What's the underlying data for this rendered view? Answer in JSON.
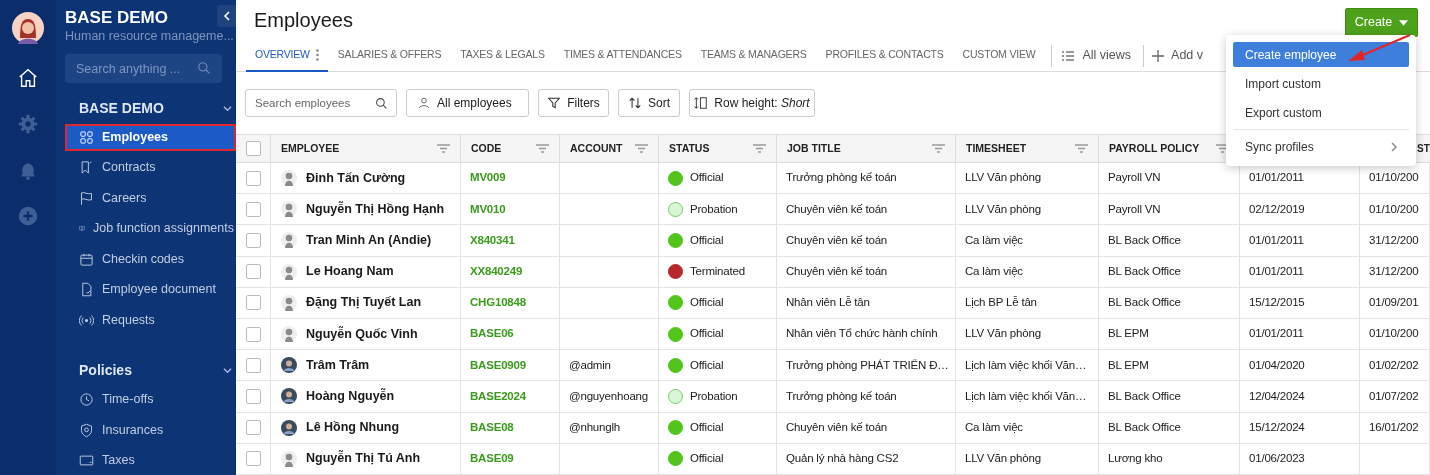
{
  "sidebar": {
    "rail": [
      {
        "selected": true
      },
      {
        "selected": false
      },
      {
        "selected": false
      },
      {
        "selected": false
      }
    ],
    "title": "BASE DEMO",
    "subtitle": "Human resource manageme...",
    "search": {
      "placeholder": "Search anything ..."
    },
    "sections": [
      {
        "label": "BASE DEMO",
        "expanded": true,
        "items": [
          {
            "label": "Employees",
            "selected": true,
            "highlighted": true
          },
          {
            "label": "Contracts",
            "selected": false,
            "highlighted": false
          },
          {
            "label": "Careers",
            "selected": false,
            "highlighted": false
          },
          {
            "label": "Job function assignments",
            "selected": false,
            "highlighted": false
          },
          {
            "label": "Checkin codes",
            "selected": false,
            "highlighted": false
          },
          {
            "label": "Employee document",
            "selected": false,
            "highlighted": false
          },
          {
            "label": "Requests",
            "selected": false,
            "highlighted": false
          }
        ]
      },
      {
        "label": "Policies",
        "expanded": true,
        "items": [
          {
            "label": "Time-offs",
            "selected": false,
            "highlighted": false
          },
          {
            "label": "Insurances",
            "selected": false,
            "highlighted": false
          },
          {
            "label": "Taxes",
            "selected": false,
            "highlighted": false
          }
        ]
      }
    ]
  },
  "page": {
    "title": "Employees",
    "create_button": "Create",
    "tabs": [
      {
        "label": "OVERVIEW",
        "selected": true
      },
      {
        "label": "SALARIES & OFFERS",
        "selected": false
      },
      {
        "label": "TAXES & LEGALS",
        "selected": false
      },
      {
        "label": "TIMES & ATTENDANCES",
        "selected": false
      },
      {
        "label": "TEAMS & MANAGERS",
        "selected": false
      },
      {
        "label": "PROFILES & CONTACTS",
        "selected": false
      },
      {
        "label": "CUSTOM VIEW",
        "selected": false
      }
    ],
    "all_views": "All views",
    "add_view": "Add v",
    "toolbar": {
      "search": {
        "placeholder": "Search employees"
      },
      "scope": "All employees",
      "filters": "Filters",
      "sort": "Sort",
      "row_height": "Row height: *Short*"
    }
  },
  "menu": {
    "items": [
      {
        "label": "Create employee",
        "selected": true,
        "submenu": false
      },
      {
        "label": "Import custom",
        "selected": false,
        "submenu": false
      },
      {
        "label": "Export custom",
        "selected": false,
        "submenu": false
      },
      {
        "label": "Sync profiles",
        "selected": false,
        "submenu": true
      }
    ]
  },
  "table": {
    "all_checked": false,
    "columns": [
      "EMPLOYEE",
      "CODE",
      "ACCOUNT",
      "STATUS",
      "JOB TITLE",
      "TIMESHEET",
      "PAYROLL POLICY"
    ],
    "column_9_header": "ST",
    "rows": [
      {
        "checked": false,
        "kind": "default",
        "name": "Đinh Tấn Cường",
        "code": "MV009",
        "status": "Official",
        "color": "#52c41a",
        "job_title": "Trưởng phòng kế toán",
        "timesheet": "LLV Văn phòng",
        "payroll_policy": "Payroll VN",
        "column_8": "01/01/2011",
        "column_9": "01/10/200"
      },
      {
        "checked": false,
        "kind": "default",
        "name": "Nguyễn Thị Hồng Hạnh",
        "code": "MV010",
        "status": "Probation",
        "color": "#d9f7d6",
        "job_title": "Chuyên viên kế toán",
        "timesheet": "LLV Văn phòng",
        "payroll_policy": "Payroll VN",
        "column_8": "02/12/2019",
        "column_9": "01/10/200"
      },
      {
        "checked": false,
        "kind": "default",
        "name": "Tran Minh An (Andie)",
        "code": "X840341",
        "status": "Official",
        "color": "#52c41a",
        "job_title": "Chuyên viên kế toán",
        "timesheet": "Ca làm việc",
        "payroll_policy": "BL Back Office",
        "column_8": "01/01/2011",
        "column_9": "31/12/200"
      },
      {
        "checked": false,
        "kind": "default",
        "name": "Le Hoang Nam",
        "code": "XX840249",
        "status": "Terminated",
        "color": "#b7282e",
        "job_title": "Chuyên viên kế toán",
        "timesheet": "Ca làm việc",
        "payroll_policy": "BL Back Office",
        "column_8": "01/01/2011",
        "column_9": "31/12/200"
      },
      {
        "checked": false,
        "kind": "default",
        "name": "Đặng Thị Tuyết Lan",
        "code": "CHG10848",
        "status": "Official",
        "color": "#52c41a",
        "job_title": "Nhân viên Lễ tân",
        "timesheet": "Lịch BP Lễ tân",
        "payroll_policy": "BL Back Office",
        "column_8": "15/12/2015",
        "column_9": "01/09/201"
      },
      {
        "checked": false,
        "kind": "default",
        "name": "Nguyễn Quốc Vinh",
        "code": "BASE06",
        "status": "Official",
        "color": "#52c41a",
        "job_title": "Nhân viên Tổ chức hành chính",
        "timesheet": "LLV Văn phòng",
        "payroll_policy": "BL EPM",
        "column_8": "01/01/2011",
        "column_9": "01/10/200"
      },
      {
        "checked": false,
        "kind": "photo",
        "name": "Trâm Trâm",
        "code": "BASE0909",
        "account": "@admin",
        "status": "Official",
        "color": "#52c41a",
        "job_title": "Trưởng phòng PHÁT TRIỂN Đ…",
        "timesheet": "Lịch làm việc khối Văn…",
        "payroll_policy": "BL EPM",
        "column_8": "01/04/2020",
        "column_9": "01/02/202"
      },
      {
        "checked": false,
        "kind": "photo",
        "name": "Hoàng Nguyễn",
        "code": "BASE2024",
        "account": "@nguyenhoang",
        "status": "Probation",
        "color": "#d9f7d6",
        "job_title": "Trưởng phòng kế toán",
        "timesheet": "Lịch làm việc khối Văn…",
        "payroll_policy": "BL Back Office",
        "column_8": "12/04/2024",
        "column_9": "01/07/202"
      },
      {
        "checked": false,
        "kind": "photo",
        "name": "Lê Hồng Nhung",
        "code": "BASE08",
        "account": "@nhunglh",
        "status": "Official",
        "color": "#52c41a",
        "job_title": "Chuyên viên kế toán",
        "timesheet": "Ca làm việc",
        "payroll_policy": "BL Back Office",
        "column_8": "15/12/2024",
        "column_9": "16/01/202"
      },
      {
        "checked": false,
        "kind": "default",
        "name": "Nguyễn Thị Tú Anh",
        "code": "BASE09",
        "status": "Official",
        "color": "#52c41a",
        "job_title": "Quản lý nhà hàng CS2",
        "timesheet": "LLV Văn phòng",
        "payroll_policy": "Lương kho",
        "column_8": "01/06/2023"
      }
    ]
  }
}
